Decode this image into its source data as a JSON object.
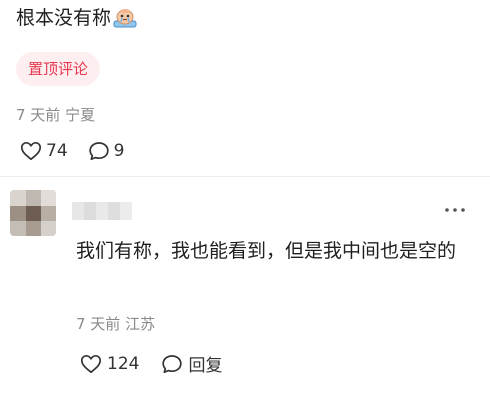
{
  "pinned_comment": {
    "text": "根本没有称",
    "emoji_icon": "bald-crying-face-icon",
    "badge": "置顶评论",
    "time": "7 天前",
    "location": "宁夏",
    "likes": "74",
    "replies": "9"
  },
  "reply_comment": {
    "text": "我们有称，我也能看到，但是我中间也是空的",
    "time": "7 天前",
    "location": "江苏",
    "likes": "124",
    "reply_label": "回复"
  },
  "icons": {
    "like": "heart-outline-icon",
    "comment": "speech-bubble-icon",
    "more": "more-dots-icon"
  },
  "colors": {
    "accent": "#e8384f",
    "badge_bg": "#fdeef0",
    "meta_text": "#8a8a8a"
  }
}
